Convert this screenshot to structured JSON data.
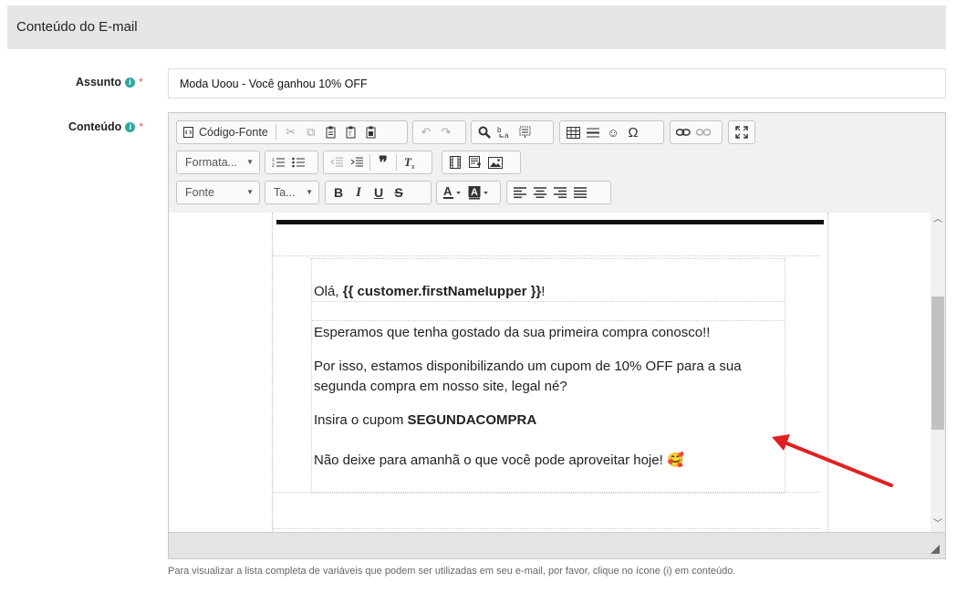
{
  "section": {
    "title": "Conteúdo do E-mail"
  },
  "subject": {
    "label": "Assunto",
    "required_mark": "*",
    "value": "Moda Uoou - Você ganhou 10% OFF"
  },
  "content": {
    "label": "Conteúdo",
    "required_mark": "*"
  },
  "info_icon": "i",
  "toolbar": {
    "source_label": "Código-Fonte",
    "format_label": "Formata...",
    "font_label": "Fonte",
    "size_label": "Ta..."
  },
  "email": {
    "greeting_prefix": "Olá, ",
    "greeting_var": "{{ customer.firstNameIupper }}",
    "greeting_suffix": "!",
    "line1": "Esperamos que tenha gostado da sua primeira compra conosco!!",
    "line2": "Por isso, estamos disponibilizando um cupom de 10% OFF para a sua",
    "line3": "segunda compra em nosso site, legal né?",
    "coupon_prefix": "Insira o cupom ",
    "coupon_code": "SEGUNDACOMPRA",
    "closing": "Não deixe para amanhã o que você pode aproveitar hoje! ",
    "emoji": "🥰"
  },
  "help": {
    "text": "Para visualizar a lista completa de variáveis que podem ser utilizadas em seu e-mail, por favor, clique no ícone (i) em conteúdo."
  },
  "colors": {
    "header_bg": "#e6e6e6",
    "info_icon": "#2ea7a0",
    "required": "#d9534f",
    "annotation_arrow": "#e02020"
  }
}
